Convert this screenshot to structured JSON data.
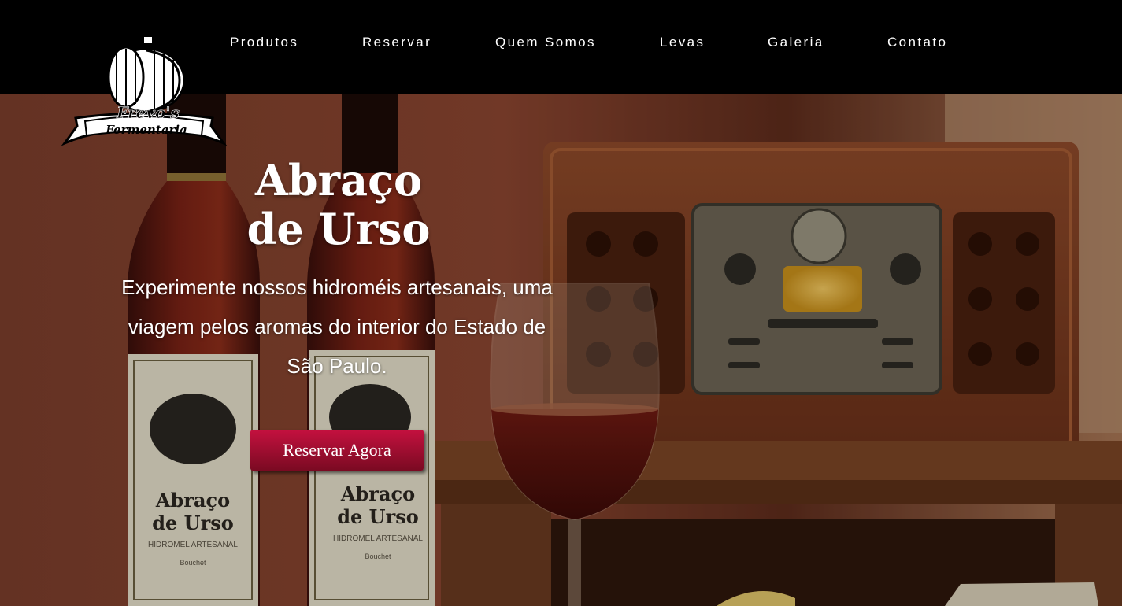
{
  "nav": {
    "items": [
      "Produtos",
      "Reservar",
      "Quem Somos",
      "Levas",
      "Galeria",
      "Contato"
    ]
  },
  "logo": {
    "line1": "Frevo's",
    "line2": "Fermentaria"
  },
  "hero": {
    "title_line1": "Abraço",
    "title_line2": "de Urso",
    "subtitle": "Experimente nossos hidroméis artesanais, uma viagem pelos aromas do interior do Estado de São Paulo.",
    "cta_label": "Reservar Agora"
  },
  "bottle_label": {
    "line1": "Abraço",
    "line2": "de Urso",
    "type": "HIDROMEL ARTESANAL",
    "maker": "Bouchet"
  },
  "colors": {
    "cta_top": "#c4113f",
    "cta_bottom": "#7a0a22",
    "topbar": "#000000"
  }
}
